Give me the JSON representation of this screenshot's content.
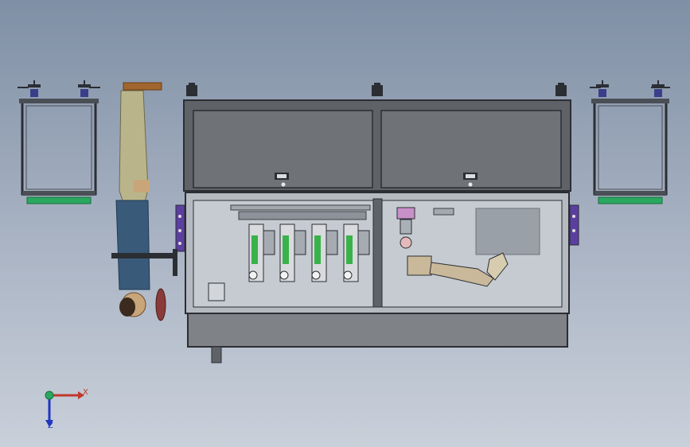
{
  "viewport": {
    "background_top": "#7f8fa5",
    "background_bottom": "#c9d0da"
  },
  "colors": {
    "frame": "#3b3f45",
    "panel": "#6f7377",
    "mesh": "#c7c22a",
    "green": "#2aa860",
    "purple": "#5b3fa0",
    "skin": "#c9a57a",
    "shirt": "#3a5a7a",
    "pants": "#b9b48a"
  },
  "triad": {
    "x_label": "X",
    "z_label": "Z",
    "icons": [
      "triad-icon"
    ]
  }
}
